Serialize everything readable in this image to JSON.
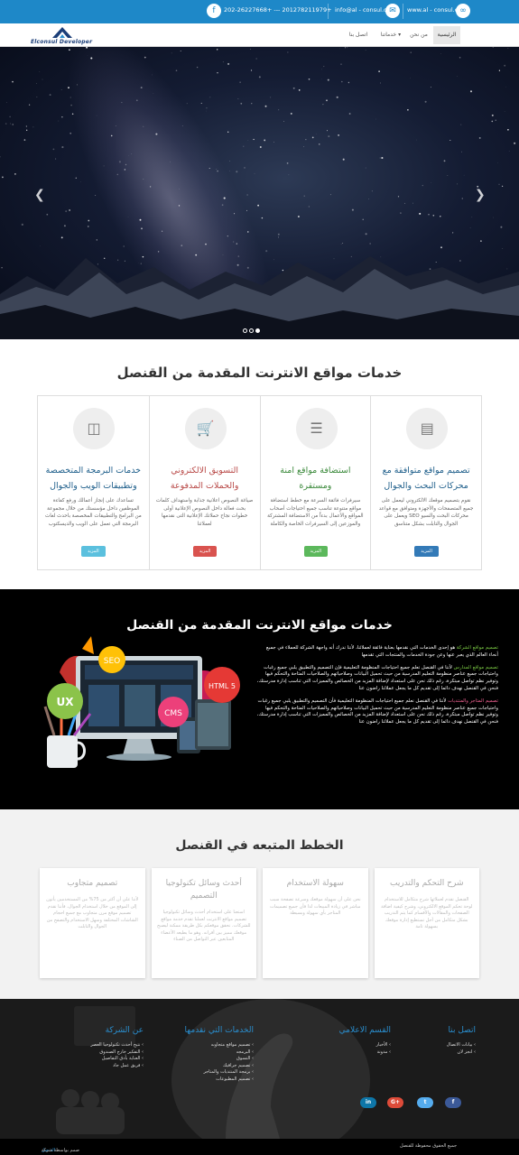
{
  "contact": {
    "website": "www.al - consul.com",
    "email": "info@al - consul.com",
    "phones": "202-26227668+ --- 201278211979+"
  },
  "logo": {
    "text": "Elconsul Developer"
  },
  "nav": {
    "home": "الرئيسية",
    "about": "من نحن",
    "services": "خدماتنا",
    "contact": "اتصل بنا"
  },
  "hero": {
    "slides": 3,
    "active_slide": 3
  },
  "services": {
    "title": "خدمات مواقع الانترنت المقدمة من القنصل",
    "items": [
      {
        "icon": "monitor-icon",
        "title": "تصميم مواقع متوافقة مع محركات البحث والجوال",
        "desc": "نقوم بتصميم موقعك الالكتروني ليعمل على جميع المتصفحات والأجهزة ومتوافق مع قواعد محركات البحث والسيو SEO ويعمل على الجوال والتابلت بشكل متناسق",
        "button": "المزيد",
        "color": "#337ab7"
      },
      {
        "icon": "server-icon",
        "title": "استضافة مواقع امنة ومستقرة",
        "desc": "سيرفرات فائقة السرعة مع خطط استضافة مواقع متنوعة تناسب جميع احتياجات أصحاب المواقع والأعمال بدءاً من الاستضافة المشتركة والموزعين إلى السيرفرات الخاصة والكاملة",
        "button": "المزيد",
        "color": "#5cb85c"
      },
      {
        "icon": "cart-icon",
        "title": "التسويق الالكتروني والحملات المدفوعة",
        "desc": "صياغة النصوص اعلانية جذابة واستهداف كلمات بحث فعالة داخل النصوص الإعلانية أولى خطوات نجاح حملاتك الإعلانية التى نقدمها لعملائنا",
        "button": "المزيد",
        "color": "#d9534f"
      },
      {
        "icon": "database-icon",
        "title": "خدمات البرمجة المتخصصة وتطبيقات الويب والجوال",
        "desc": "تساعدك على إنجاز أعمالك ورفع كفاءة الموظفين داخل مؤسستك من خلال مجموعة من البرامج والتطبيقات المخصصة باحدث لغات البرمجة التي تعمل على الويب والديسكتوب",
        "button": "المزيد",
        "color": "#5bc0de"
      }
    ]
  },
  "showcase": {
    "title": "خدمات مواقع الانترنت المقدمة من القنصل",
    "para1_hl": "تصميم مواقع الشركة",
    "para1": " هو إحدى الخدمات التي نقدمها بعناية فائقة لعملائنا، لأننا ندرك أنه واجهة الشركة للعملاء في جميع أنحاء العالم الذي يعبر عنها وعن جودة الخدمات والمنتجات التي تقدمها",
    "para2_hl": "تصميم مواقع المدارس",
    "para2": " لأننا في القنصل نعلم جميع احتياجات المنظومة التعليمية فإن التصميم والتطبيق يلبي جميع رغبات واحتياجات جميع عناصر منظومة التعليم المدرسية من حيث تحميل البيانات وصلاحياتهم والصلاحيات المتاحة والتحكم فيها وتوفير نظم تواصل مبتكرة، رغم ذلك نحن على استعداد لإضافة المزيد من الخصائص والمميزات التي تناسب إدارة مدرستك، فنحن في القنصل نهدف دائما إلى تقديم كل ما يجعل عملائنا راضون عنا",
    "para3_hl": "تصميم المتاجر والمنتديات",
    "para3": " لأننا في القنصل نعلم جميع احتياجات المنظومة التعليمية فأن التصميم والتطبيق يلبي جميع رغبات واحتياجات جميع عناصر منظومة التعليم المدرسية من حيث تحميل البيانات وصلاحياتهم والصلاحيات المتاحة والتحكم فيها وتوفير نظم تواصل مبتكرة، رغم ذلك نحن على استعداد لإضافة المزيد من الخصائص والمميزات التي تناسب إدارة مدرستك، فنحن في القنصل نهدف دائما إلى تقديم كل ما يجعل عملائنا راضون عنا",
    "badges": [
      "SEO",
      "UX",
      "HTML 5",
      "CMS"
    ]
  },
  "plan": {
    "title": "الخطط المتبعه في القنصل",
    "cards": [
      {
        "title": "شرح التحكم والتدريب",
        "desc": "القنصل تقدم لعملائها شرح متكامل للاستخدام لوحة تحكم الموقع الالكتروني، وشرح كيفية اضافة الصفحات والمقالات والأقسام كما يتم التدريب بشكل متكامل من أجل تستطيع إدارة موقعك بسهولة تامة"
      },
      {
        "title": "سهولة الاستخدام",
        "desc": "نحن على أن سهولة موقعك وسرعة تصفحة سبب مباشر في زيادة المبيعات لذا فأن جميع تصميمات المتاجر بأي سهولة وبسيطة"
      },
      {
        "title": "أحدث وسائل تكنولوجيا التصميم",
        "desc": "استعنا على استخدام أحدث وسائل تكنولوجيا تصميم مواقع الانترنت لعملنا تقدم خدمة مواقع للشركات. نحقق موقعكم بكل طريقة ممكنة ليصبح موقعك مميز بين أقرانه. وهو ما يطيعه الأعضاء المتابعين عبر التواصل من الصناء"
      },
      {
        "title": "تصميم متجاوب",
        "desc": "لأننا علي أن أكثر من 75% من المستخدمين يأتون إلى الموقع من خلال استخدام الجوال، فأننا نقدم تصميم موقع مرن متجاوب مع جميع احجام الشاشات المختلفة وسهل الاستخدام والتصفح من الجوال والتابلت"
      }
    ]
  },
  "footer": {
    "contact": {
      "title": "اتصل بنا",
      "items": [
        "بيانات الاتصال",
        "انجز لان"
      ]
    },
    "media": {
      "title": "القسم الاعلامي",
      "items": [
        "الأخبار",
        "مدونة"
      ]
    },
    "services": {
      "title": "الخدمات التي نقدمها",
      "items": [
        "تصميم مواقع متجاوبه",
        "البرمجه",
        "التسوق",
        "تصميم جرافيك",
        "برمجة المنتديات والمتاجر",
        "تصميم المطبوعات"
      ]
    },
    "company": {
      "title": "عن الشركة",
      "items": [
        "نتيح أحدث تكنولوجيا العصر",
        "التفكير خارج الصندوق",
        "العناية بأدق التفاصيل",
        "فريق عمل جاد"
      ]
    },
    "socials": [
      {
        "label": "in",
        "color": "#0e76a8"
      },
      {
        "label": "G+",
        "color": "#dd4b39"
      },
      {
        "label": "t",
        "color": "#55acee"
      },
      {
        "label": "f",
        "color": "#3b5998"
      }
    ]
  },
  "bottom": {
    "rights": "جميع الحقوق محفوظة للقنصل",
    "credit_prefix": "صمم بواسطة شركة",
    "credit_link": "القنصل"
  }
}
